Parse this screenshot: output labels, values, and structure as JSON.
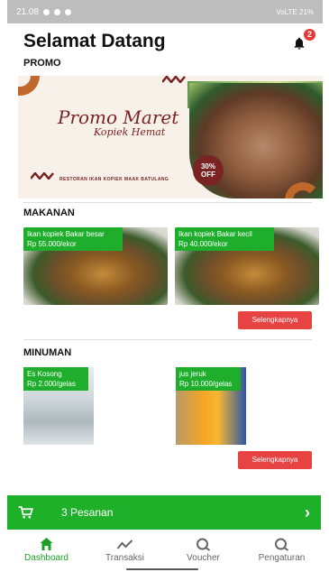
{
  "status_bar": {
    "time": "21.08",
    "right_text": "VoLTE 21%"
  },
  "header": {
    "title": "Selamat Datang",
    "notification_count": "2"
  },
  "promo": {
    "label": "PROMO",
    "banner_title": "Promo Maret",
    "banner_subtitle": "Kopiek Hemat",
    "discount": "30% OFF",
    "restaurant": "RESTORAN IKAN KOPIEK MAAK BATULANG"
  },
  "makanan": {
    "label": "MAKANAN",
    "items": [
      {
        "name": "Ikan kopiek Bakar besar",
        "price": "Rp 55.000/ekor"
      },
      {
        "name": "Ikan kopiek Bakar kecil",
        "price": "Rp 40.000/ekor"
      }
    ],
    "more_label": "Selengkapnya"
  },
  "minuman": {
    "label": "MINUMAN",
    "items": [
      {
        "name": "Es Kosong",
        "price": "Rp 2.000/gelas"
      },
      {
        "name": "jus jeruk",
        "price": "Rp 10.000/gelas"
      }
    ],
    "more_label": "Selengkapnya"
  },
  "cart": {
    "label": "3 Pesanan"
  },
  "nav": {
    "items": [
      {
        "label": "Dashboard",
        "icon": "home-icon",
        "active": true
      },
      {
        "label": "Transaksi",
        "icon": "trend-icon",
        "active": false
      },
      {
        "label": "Voucher",
        "icon": "voucher-icon",
        "active": false
      },
      {
        "label": "Pengaturan",
        "icon": "settings-icon",
        "active": false
      }
    ]
  },
  "colors": {
    "accent_green": "#1fb02a",
    "button_red": "#e84343",
    "badge_red": "#e53935"
  }
}
